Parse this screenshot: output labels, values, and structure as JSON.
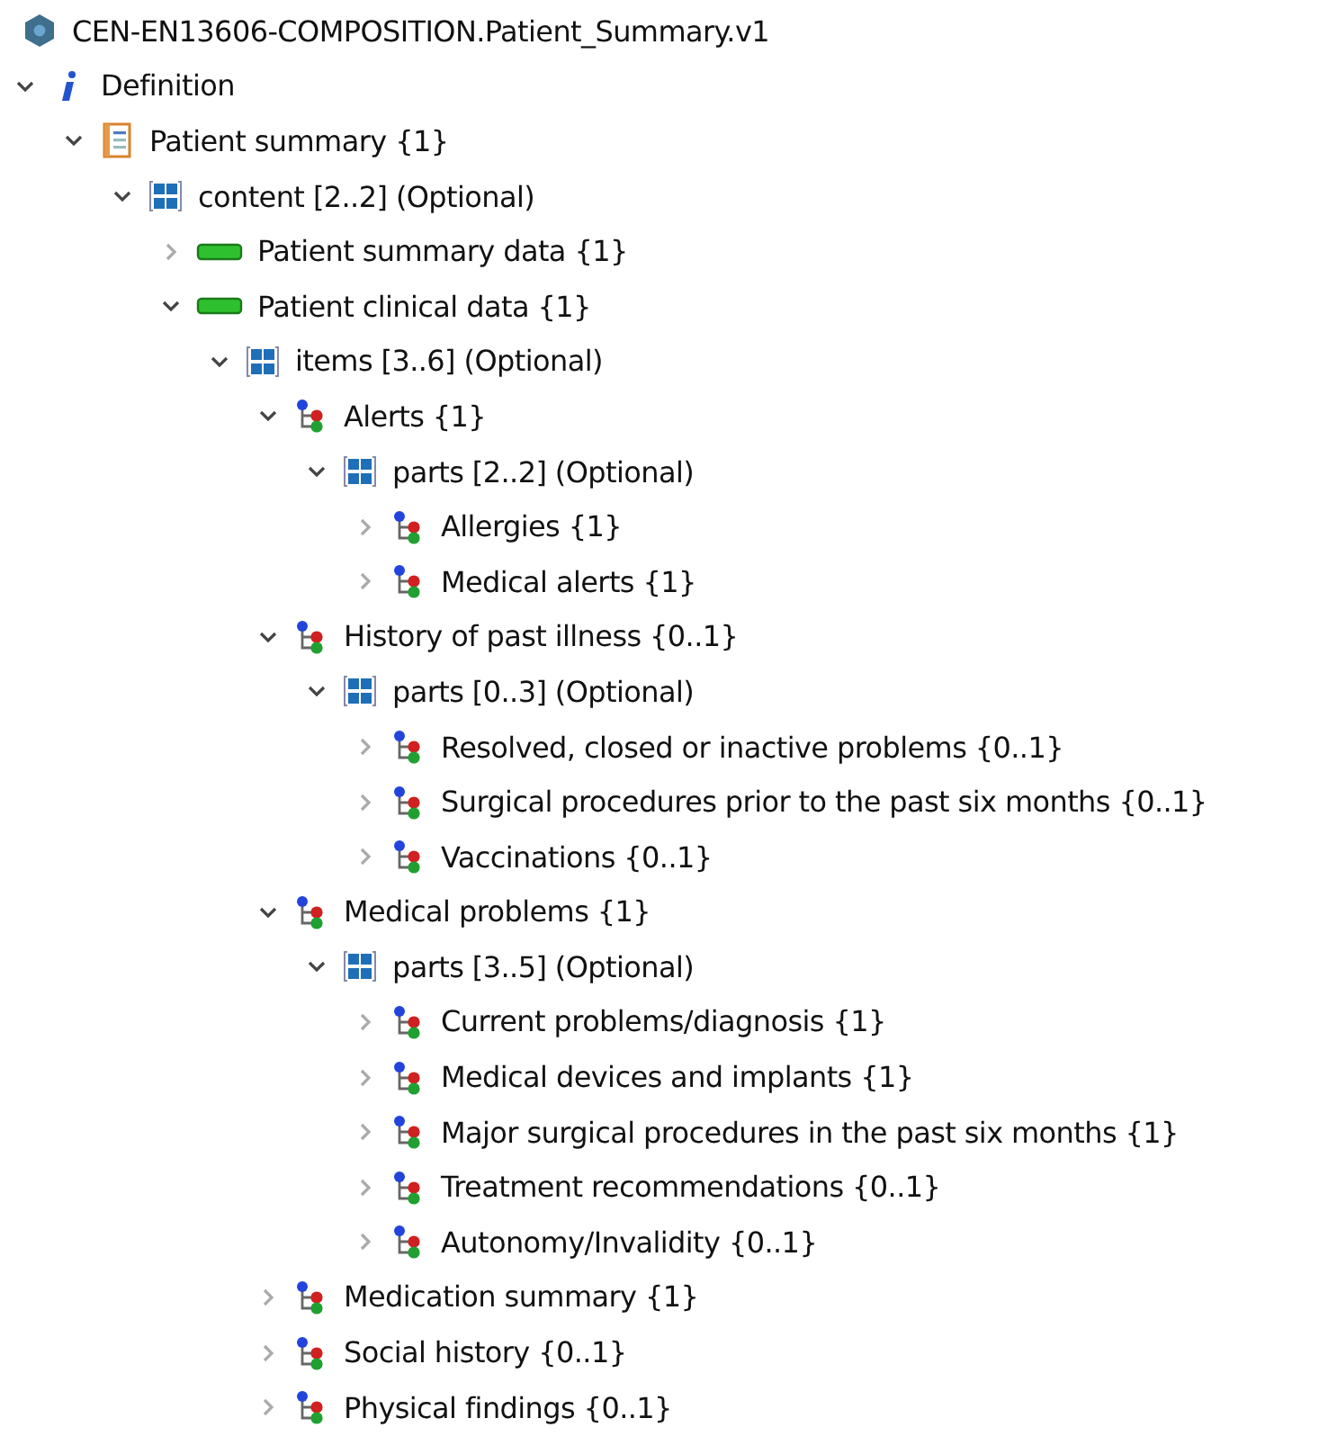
{
  "root": {
    "title": "CEN-EN13606-COMPOSITION.Patient_Summary.v1",
    "kind": "archetype"
  },
  "tree": [
    {
      "label": "Definition",
      "kind": "info",
      "expanded": true,
      "children": [
        {
          "label": "Patient summary {1}",
          "kind": "document",
          "expanded": true,
          "children": [
            {
              "label": "content [2..2] (Optional)",
              "kind": "list",
              "expanded": true,
              "children": [
                {
                  "label": "Patient summary data {1}",
                  "kind": "section",
                  "expanded": false
                },
                {
                  "label": "Patient clinical data {1}",
                  "kind": "section",
                  "expanded": true,
                  "children": [
                    {
                      "label": "items [3..6] (Optional)",
                      "kind": "list",
                      "expanded": true,
                      "children": [
                        {
                          "label": "Alerts {1}",
                          "kind": "entry",
                          "expanded": true,
                          "children": [
                            {
                              "label": "parts [2..2] (Optional)",
                              "kind": "list",
                              "expanded": true,
                              "children": [
                                {
                                  "label": "Allergies {1}",
                                  "kind": "entry",
                                  "expanded": false
                                },
                                {
                                  "label": "Medical alerts {1}",
                                  "kind": "entry",
                                  "expanded": false
                                }
                              ]
                            }
                          ]
                        },
                        {
                          "label": "History of past illness {0..1}",
                          "kind": "entry",
                          "expanded": true,
                          "children": [
                            {
                              "label": "parts [0..3] (Optional)",
                              "kind": "list",
                              "expanded": true,
                              "children": [
                                {
                                  "label": "Resolved, closed or inactive problems {0..1}",
                                  "kind": "entry",
                                  "expanded": false
                                },
                                {
                                  "label": "Surgical procedures prior to the past six months {0..1}",
                                  "kind": "entry",
                                  "expanded": false
                                },
                                {
                                  "label": "Vaccinations {0..1}",
                                  "kind": "entry",
                                  "expanded": false
                                }
                              ]
                            }
                          ]
                        },
                        {
                          "label": "Medical problems {1}",
                          "kind": "entry",
                          "expanded": true,
                          "children": [
                            {
                              "label": "parts [3..5] (Optional)",
                              "kind": "list",
                              "expanded": true,
                              "children": [
                                {
                                  "label": "Current problems/diagnosis {1}",
                                  "kind": "entry",
                                  "expanded": false
                                },
                                {
                                  "label": "Medical devices and implants {1}",
                                  "kind": "entry",
                                  "expanded": false
                                },
                                {
                                  "label": "Major surgical procedures in the past six months {1}",
                                  "kind": "entry",
                                  "expanded": false
                                },
                                {
                                  "label": "Treatment recommendations {0..1}",
                                  "kind": "entry",
                                  "expanded": false
                                },
                                {
                                  "label": "Autonomy/Invalidity {0..1}",
                                  "kind": "entry",
                                  "expanded": false
                                }
                              ]
                            }
                          ]
                        },
                        {
                          "label": "Medication summary {1}",
                          "kind": "entry",
                          "expanded": false
                        },
                        {
                          "label": "Social history {0..1}",
                          "kind": "entry",
                          "expanded": false
                        },
                        {
                          "label": "Physical findings {0..1}",
                          "kind": "entry",
                          "expanded": false
                        }
                      ]
                    }
                  ]
                }
              ]
            }
          ]
        }
      ]
    }
  ]
}
